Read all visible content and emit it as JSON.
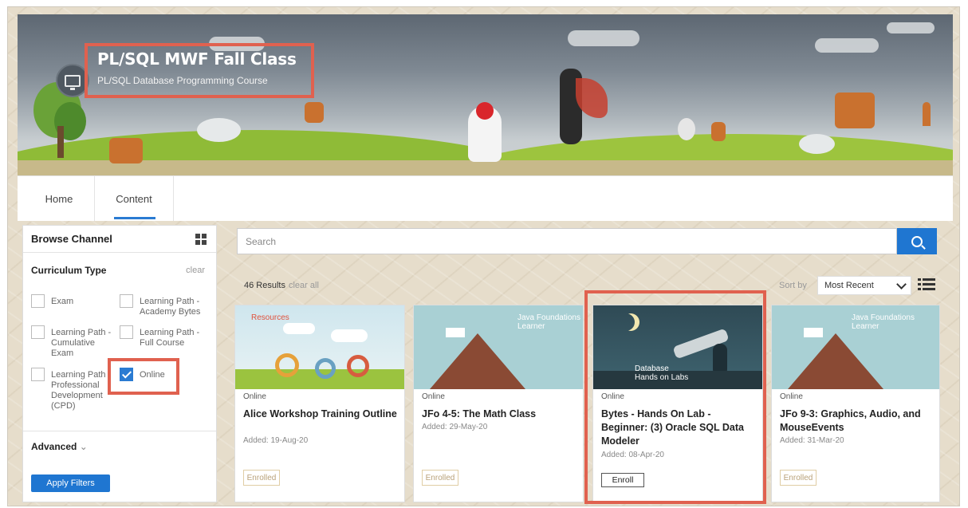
{
  "header": {
    "title": "PL/SQL MWF Fall Class",
    "subtitle": "PL/SQL Database Programming Course"
  },
  "tabs": [
    {
      "label": "Home"
    },
    {
      "label": "Content",
      "active": true
    }
  ],
  "sidebar": {
    "title": "Browse Channel",
    "section": "Curriculum Type",
    "clear": "clear",
    "options": [
      {
        "label": "Exam",
        "checked": false
      },
      {
        "label": "Learning Path - Academy Bytes",
        "checked": false
      },
      {
        "label": "Learning Path - Cumulative Exam",
        "checked": false
      },
      {
        "label": "Learning Path - Full Course",
        "checked": false
      },
      {
        "label": "Learning Path - Professional Development (CPD)",
        "checked": false
      },
      {
        "label": "Online",
        "checked": true
      }
    ],
    "advanced": "Advanced",
    "apply": "Apply Filters"
  },
  "search": {
    "placeholder": "Search"
  },
  "results": {
    "count": "46 Results",
    "clear": "clear all"
  },
  "sort": {
    "label": "Sort by",
    "value": "Most Recent"
  },
  "cards": [
    {
      "type": "Online",
      "title": "Alice Workshop Training Outline",
      "added": "Added: 19-Aug-20",
      "status": "Enrolled",
      "thumb_label": "Resources"
    },
    {
      "type": "Online",
      "title": "JFo 4-5: The Math Class",
      "added": "Added: 29-May-20",
      "status": "Enrolled",
      "thumb_label": "Java Foundations Learner"
    },
    {
      "type": "Online",
      "title": "Bytes - Hands On Lab - Beginner: (3) Oracle SQL Data Modeler",
      "added": "Added: 08-Apr-20",
      "status": "Enroll",
      "thumb_label": "Database Hands on Labs"
    },
    {
      "type": "Online",
      "title": "JFo 9-3: Graphics, Audio, and MouseEvents",
      "added": "Added: 31-Mar-20",
      "status": "Enrolled",
      "thumb_label": "Java Foundations Learner"
    }
  ],
  "colors": {
    "accent": "#1f76d1",
    "highlight": "#e0614f"
  }
}
